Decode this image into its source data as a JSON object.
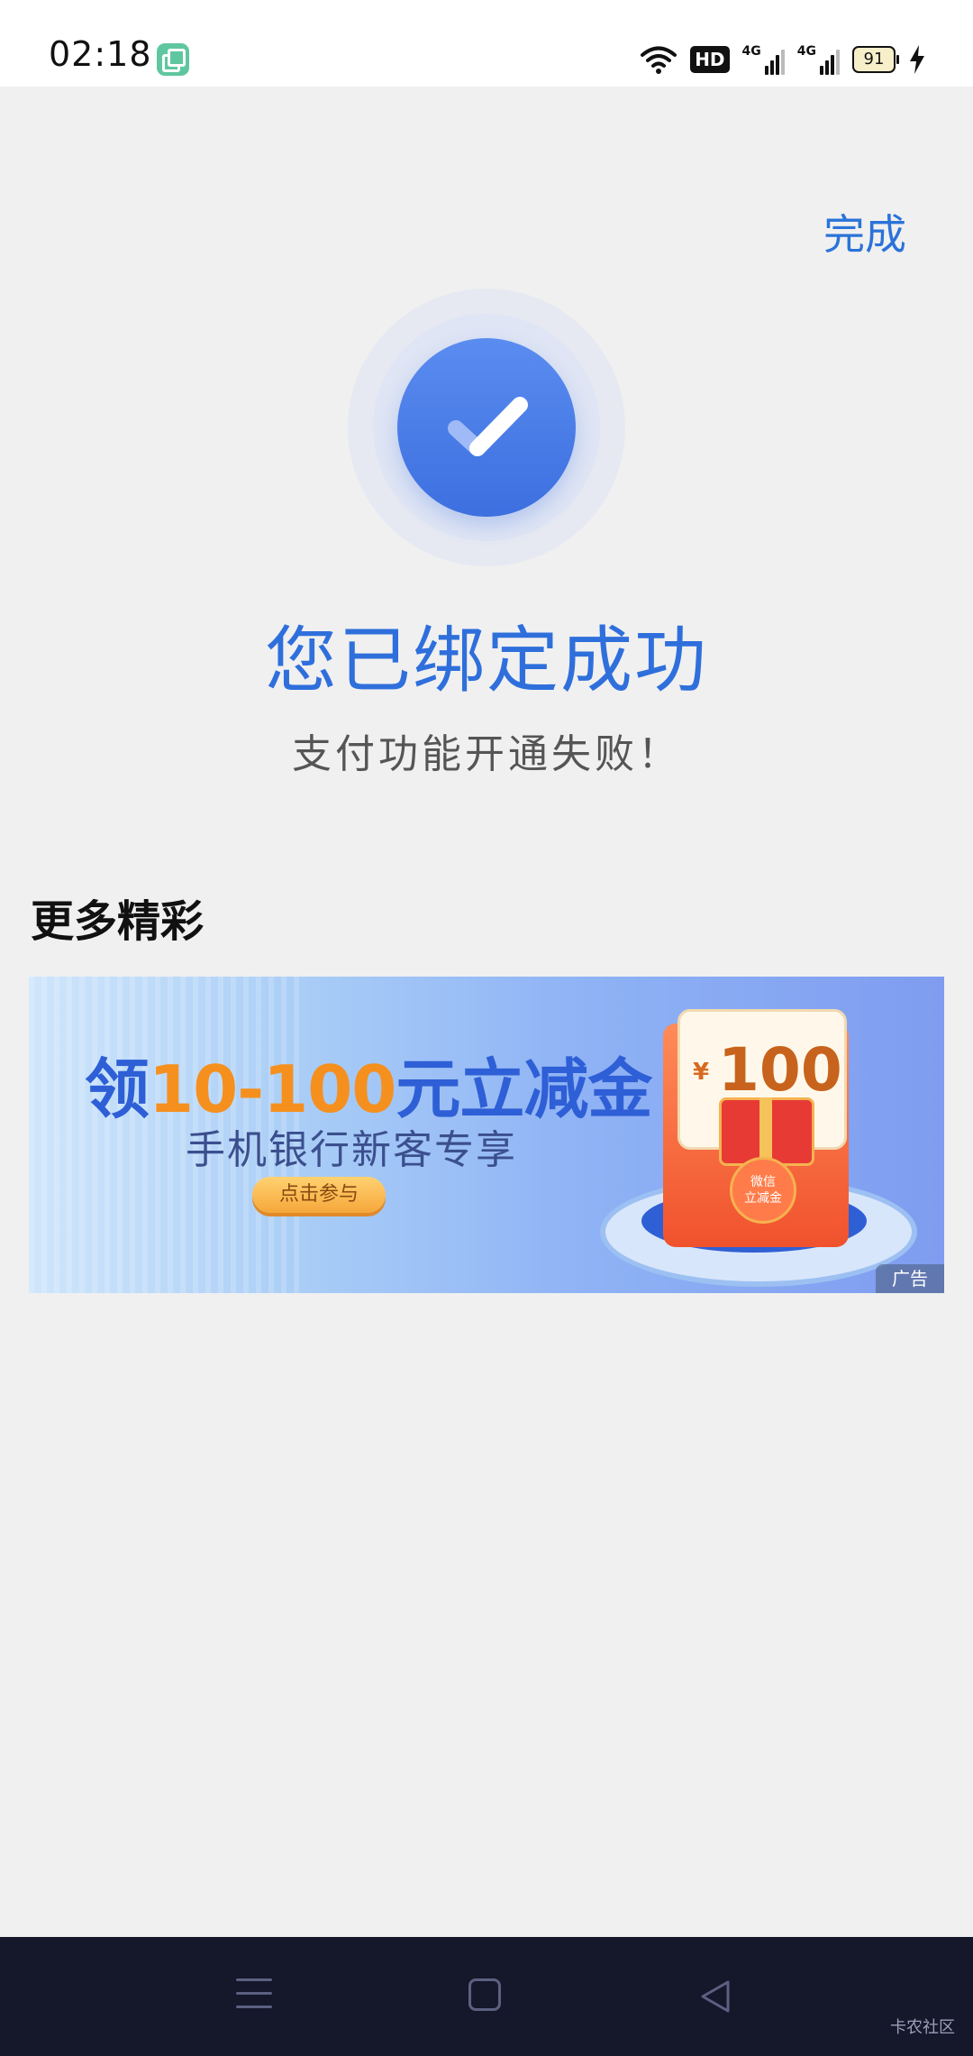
{
  "status_bar": {
    "time": "02:18",
    "hd_label": "HD",
    "network_1": "4G",
    "network_2": "4G",
    "battery_level": "91",
    "icons": [
      "app-icon",
      "wifi-icon",
      "hd-icon",
      "signal-icon",
      "signal-icon",
      "battery-icon",
      "charging-icon"
    ]
  },
  "header": {
    "done_label": "完成"
  },
  "result": {
    "icon": "check-circle-icon",
    "title": "您已绑定成功",
    "subtitle": "支付功能开通失败！",
    "accent_color": "#2f6fdc"
  },
  "more": {
    "section_title": "更多精彩",
    "banner": {
      "headline_prefix": "领",
      "headline_highlight": "10-100",
      "headline_suffix": "元立减金",
      "subtitle": "手机银行新客专享",
      "cta_label": "点击参与",
      "card_currency": "¥",
      "card_amount": "100",
      "seal_line1": "微信",
      "seal_line2": "立减金",
      "ad_tag": "广告"
    }
  },
  "nav_bar": {
    "icons": [
      "menu-icon",
      "home-icon",
      "back-icon"
    ]
  },
  "watermark": "卡农社区"
}
